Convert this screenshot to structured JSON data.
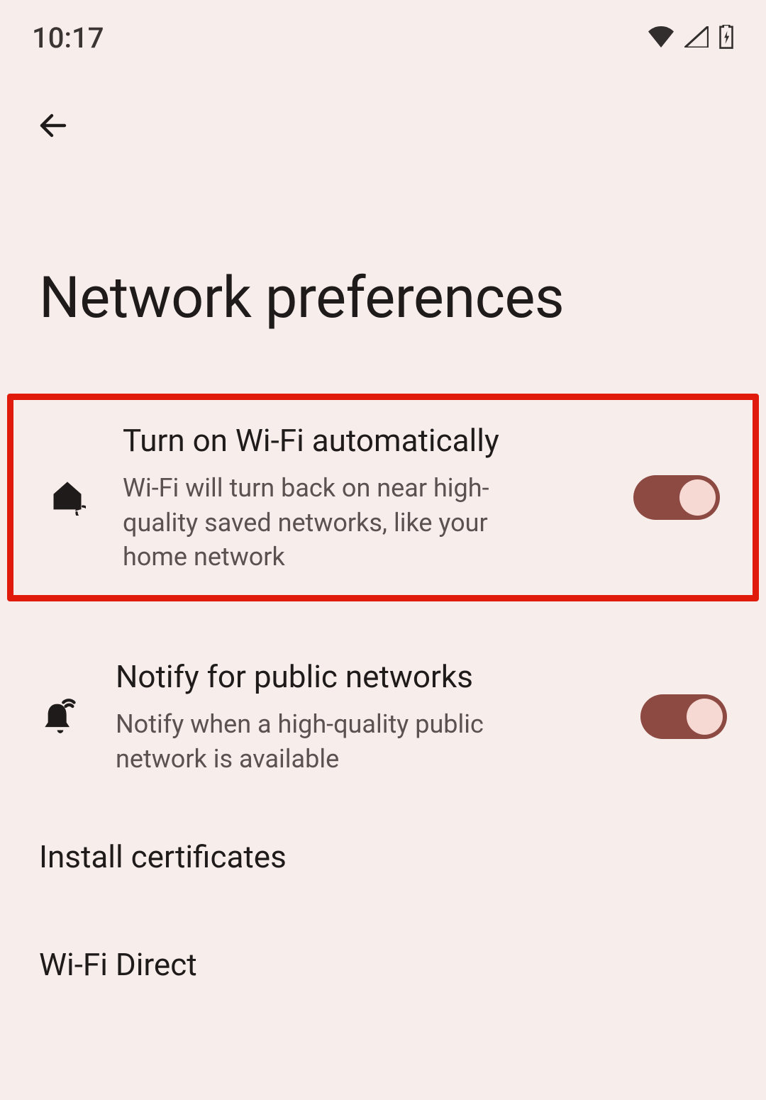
{
  "status_bar": {
    "time": "10:17"
  },
  "page": {
    "title": "Network preferences"
  },
  "settings": {
    "auto_wifi": {
      "title": "Turn on Wi-Fi automatically",
      "subtitle": "Wi-Fi will turn back on near high-quality saved networks, like your home network",
      "enabled": true,
      "highlighted": true
    },
    "notify_public": {
      "title": "Notify for public networks",
      "subtitle": "Notify when a high-quality public network is available",
      "enabled": true
    },
    "install_certs": {
      "title": "Install certificates"
    },
    "wifi_direct": {
      "title": "Wi-Fi Direct"
    }
  }
}
